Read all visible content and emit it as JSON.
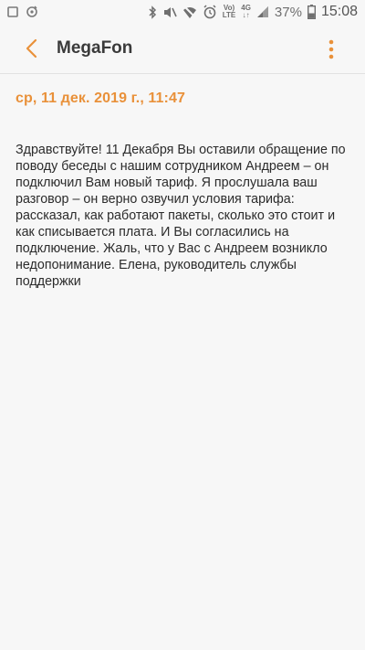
{
  "status_bar": {
    "network_label_top": "Vo)",
    "network_label_bottom": "LTE",
    "signal_label": "4G",
    "battery": "37%",
    "time": "15:08",
    "icons": [
      "notification-icon",
      "sync-icon",
      "bluetooth-icon",
      "mute-icon",
      "wifi-off-icon",
      "alarm-icon",
      "signal-icon",
      "battery-icon"
    ]
  },
  "app_bar": {
    "title": "MegaFon",
    "accent_color": "#e9913a"
  },
  "message": {
    "date": "ср, 11 дек. 2019 г., 11:47",
    "body": "Здравствуйте! 11 Декабря Вы оставили обращение по поводу беседы с нашим сотрудником Андреем – он подключил Вам новый тариф. Я прослушала ваш разговор – он верно озвучил условия тарифа: рассказал, как работают пакеты, сколько это стоит и как списывается плата. И Вы согласились на подключение. Жаль, что у Вас с Андреем возникло недопонимание. Елена, руководитель службы поддержки"
  }
}
